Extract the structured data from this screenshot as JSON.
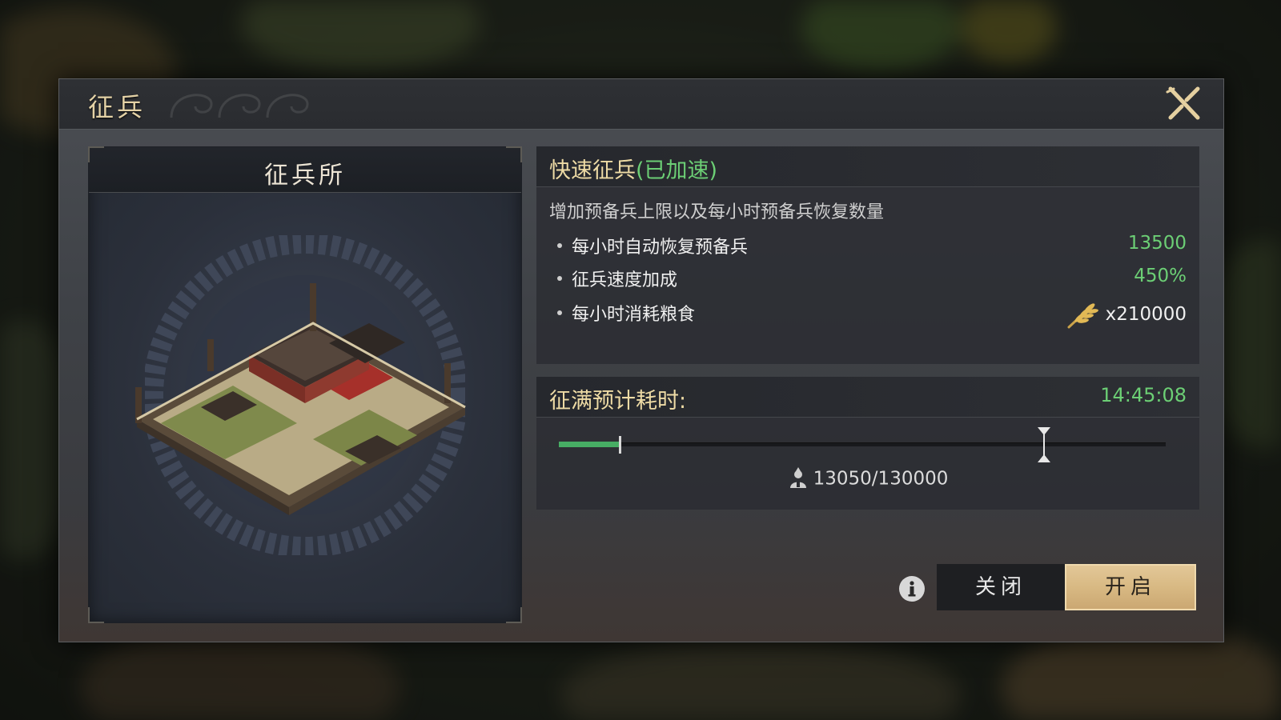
{
  "dialog": {
    "title": "征兵",
    "building_panel": {
      "title": "征兵所"
    },
    "quick_conscription": {
      "title": "快速征兵",
      "status": "(已加速)",
      "description": "增加预备兵上限以及每小时预备兵恢复数量",
      "rows": [
        {
          "label": "每小时自动恢复预备兵",
          "value": "13500"
        },
        {
          "label": "征兵速度加成",
          "value": "450%"
        },
        {
          "label": "每小时消耗粮食",
          "value": "x210000",
          "icon": "wheat-icon"
        }
      ]
    },
    "fill_time": {
      "label": "征满预计耗时:",
      "value": "14:45:08",
      "progress": 0.1004,
      "marker_fraction": 0.8,
      "count": "13050/130000"
    },
    "buttons": {
      "close": "关闭",
      "open": "开启"
    }
  },
  "colors": {
    "accent_green": "#6ccf75",
    "gold_title": "#eedba5",
    "open_button": "#d8b983"
  }
}
